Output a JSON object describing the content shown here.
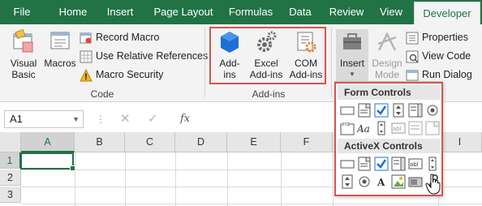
{
  "tabs": [
    {
      "label": "File",
      "active": false
    },
    {
      "label": "Home",
      "active": false
    },
    {
      "label": "Insert",
      "active": false
    },
    {
      "label": "Page Layout",
      "active": false
    },
    {
      "label": "Formulas",
      "active": false
    },
    {
      "label": "Data",
      "active": false
    },
    {
      "label": "Review",
      "active": false
    },
    {
      "label": "View",
      "active": false
    },
    {
      "label": "Developer",
      "active": true
    }
  ],
  "code_group": {
    "label": "Code",
    "visual_basic": "Visual Basic",
    "macros": "Macros",
    "record_macro": "Record Macro",
    "use_relative_references": "Use Relative References",
    "macro_security": "Macro Security"
  },
  "addins_group": {
    "label": "Add-ins",
    "addins": "Add-ins",
    "excel_addins": "Excel Add-ins",
    "com_addins": "COM Add-ins"
  },
  "controls_group": {
    "insert": "Insert",
    "design_mode": "Design Mode",
    "properties": "Properties",
    "view_code": "View Code",
    "run_dialog": "Run Dialog"
  },
  "formula_bar": {
    "name_box": "A1",
    "fx": "fx"
  },
  "columns": [
    "A",
    "B",
    "C",
    "D",
    "E",
    "F",
    "I"
  ],
  "rows": [
    "1",
    "2",
    "3"
  ],
  "gallery": {
    "form_controls_title": "Form Controls",
    "activex_controls_title": "ActiveX Controls"
  },
  "colors": {
    "accent": "#217346",
    "highlight_box": "#d9534f",
    "addin_blue": "#1e6fd9",
    "gear_gray": "#6d6d6d"
  }
}
